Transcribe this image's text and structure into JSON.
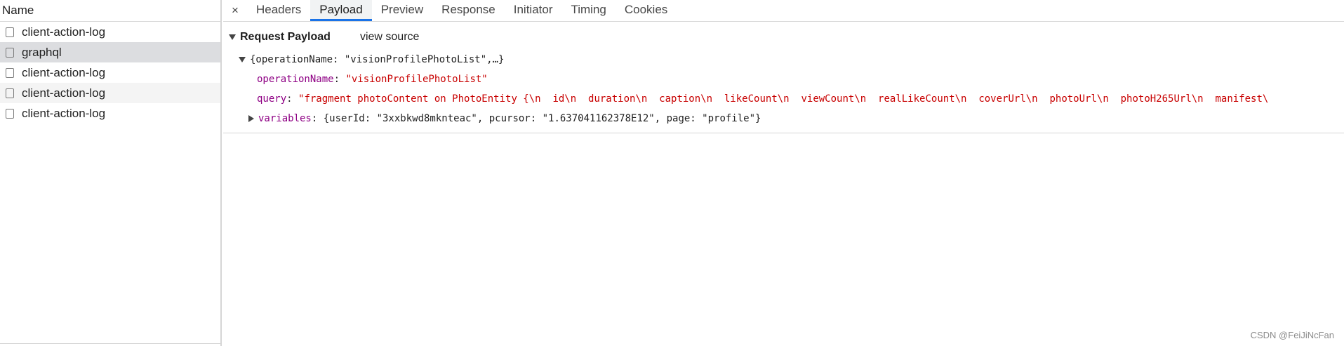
{
  "request_list": {
    "header": "Name",
    "items": [
      {
        "name": "client-action-log",
        "selected": false
      },
      {
        "name": "graphql",
        "selected": true
      },
      {
        "name": "client-action-log",
        "selected": false
      },
      {
        "name": "client-action-log",
        "selected": false
      },
      {
        "name": "client-action-log",
        "selected": false
      }
    ]
  },
  "tabs": {
    "close_label": "×",
    "items": [
      "Headers",
      "Payload",
      "Preview",
      "Response",
      "Initiator",
      "Timing",
      "Cookies"
    ],
    "active": "Payload"
  },
  "payload": {
    "title": "Request Payload",
    "view_source_label": "view source",
    "root_summary": "{operationName: \"visionProfilePhotoList\",…}",
    "operation_name": {
      "key": "operationName",
      "value": "\"visionProfilePhotoList\""
    },
    "query": {
      "key": "query",
      "value": "\"fragment photoContent on PhotoEntity {\\n  id\\n  duration\\n  caption\\n  likeCount\\n  viewCount\\n  realLikeCount\\n  coverUrl\\n  photoUrl\\n  photoH265Url\\n  manifest\\"
    },
    "variables": {
      "key": "variables",
      "value": "{userId: \"3xxbkwd8mknteac\", pcursor: \"1.637041162378E12\", page: \"profile\"}"
    }
  },
  "watermark": "CSDN @FeiJiNcFan",
  "colors": {
    "accent_tab": "#1a73e8",
    "key_color": "#881280",
    "string_color": "#c80000",
    "selected_row": "#dcdde0"
  }
}
